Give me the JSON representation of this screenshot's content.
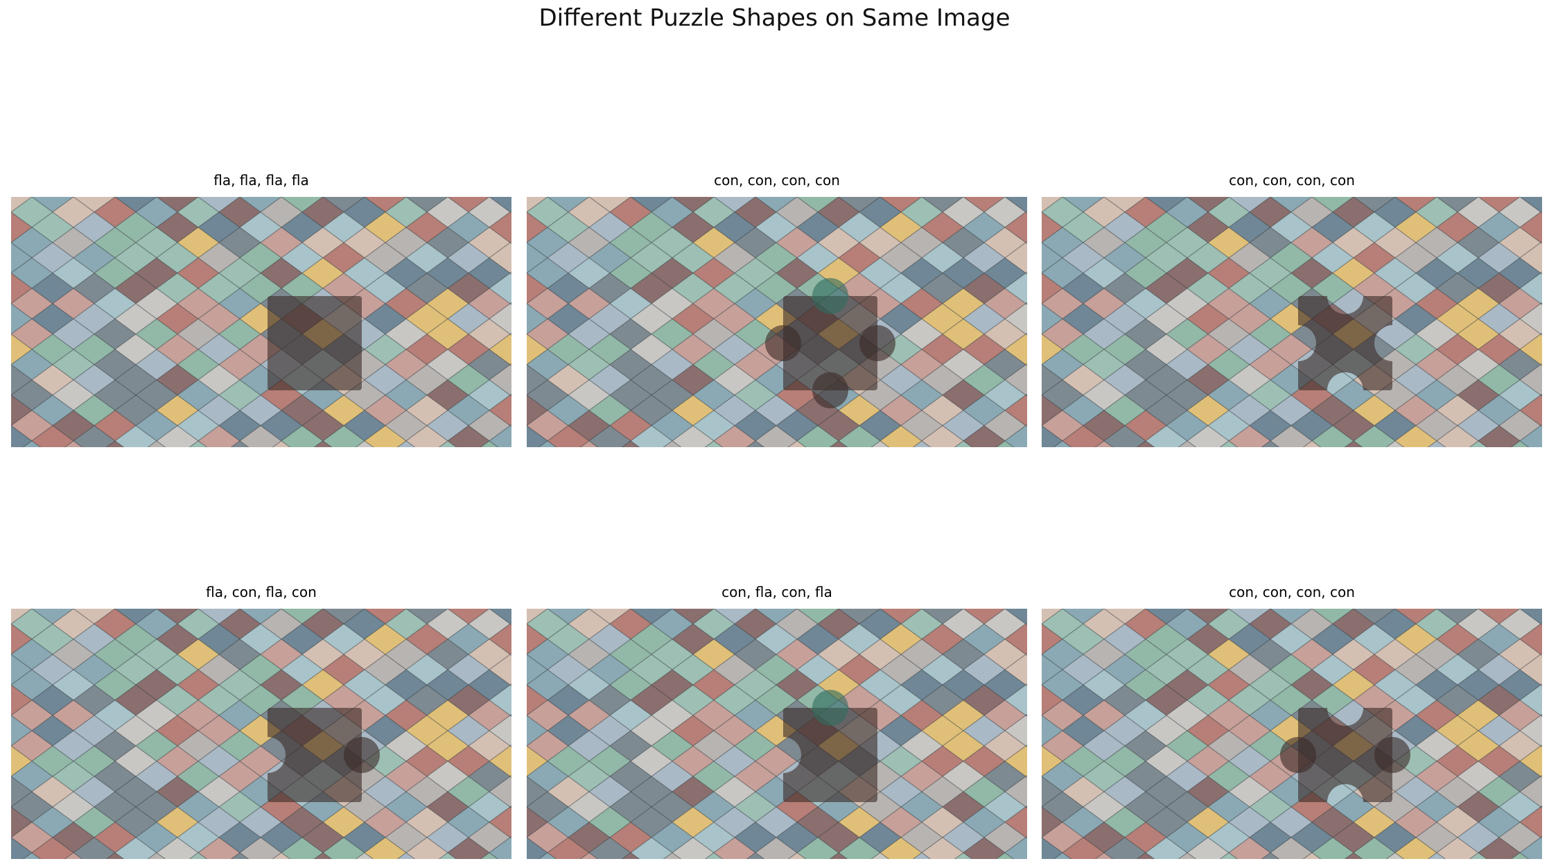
{
  "figure": {
    "title": "Different Puzzle Shapes on Same Image"
  },
  "palette": {
    "tiles": [
      "#8aa9b4",
      "#a8c3c9",
      "#9dbfb4",
      "#b8b4b2",
      "#c7a09a",
      "#a9b9c6",
      "#7e8a92",
      "#d4c0b3",
      "#92b8a7",
      "#6f8796",
      "#b77f77",
      "#c8c7c4",
      "#8b6f6e",
      "#e0c079"
    ],
    "grout": "#2e3436",
    "overlay": "#3a2a26",
    "teal_knob": "#2e6b5e"
  },
  "panels": [
    {
      "title": "fla, fla, fla, fla",
      "shape": "square-piece"
    },
    {
      "title": "con, con, con, con",
      "shape": "all-knob-piece"
    },
    {
      "title": "con, con, con, con",
      "shape": "notched-piece"
    },
    {
      "title": "fla, con, fla, con",
      "shape": "right-knob-left-notch-piece"
    },
    {
      "title": "con, fla, con, fla",
      "shape": "top-knob-bottom-notch-piece"
    },
    {
      "title": "con, con, con, con",
      "shape": "side-knob-top-bottom-notch-piece"
    }
  ]
}
